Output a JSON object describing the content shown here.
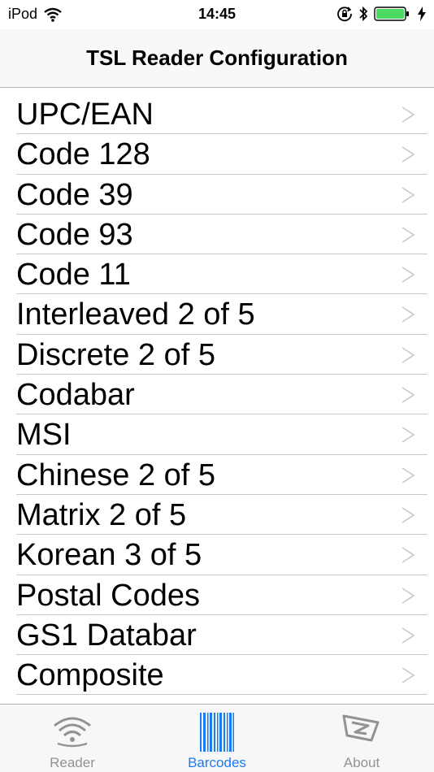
{
  "status_bar": {
    "carrier": "iPod",
    "time": "14:45"
  },
  "nav": {
    "title": "TSL Reader Configuration"
  },
  "list": {
    "items": [
      {
        "label": "UPC/EAN"
      },
      {
        "label": "Code 128"
      },
      {
        "label": "Code 39"
      },
      {
        "label": "Code 93"
      },
      {
        "label": "Code 11"
      },
      {
        "label": "Interleaved 2 of 5"
      },
      {
        "label": "Discrete 2 of 5"
      },
      {
        "label": "Codabar"
      },
      {
        "label": "MSI"
      },
      {
        "label": "Chinese 2 of 5"
      },
      {
        "label": "Matrix 2 of 5"
      },
      {
        "label": "Korean 3 of 5"
      },
      {
        "label": "Postal Codes"
      },
      {
        "label": "GS1 Databar"
      },
      {
        "label": "Composite"
      }
    ],
    "chevron_glyph": ">"
  },
  "tabs": [
    {
      "label": "Reader",
      "icon": "reader-wireless-icon",
      "selected": false
    },
    {
      "label": "Barcodes",
      "icon": "barcode-icon",
      "selected": true
    },
    {
      "label": "About",
      "icon": "tsl-logo-icon",
      "selected": false
    }
  ],
  "colors": {
    "tab_selected": "#1a7cf5",
    "tab_unselected": "#929292",
    "chevron": "#c7c7cc",
    "battery": "#4cd964"
  }
}
